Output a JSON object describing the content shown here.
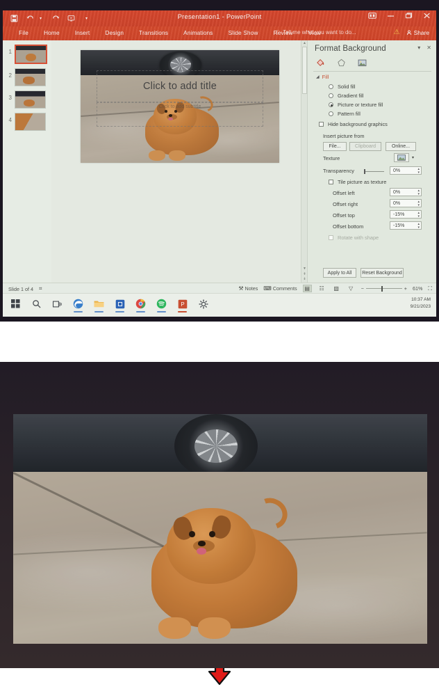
{
  "app": {
    "title": "Presentation1 - PowerPoint",
    "accent_color": "#e23d20",
    "quick_access": [
      {
        "name": "save-icon",
        "glyph": "⬜"
      },
      {
        "name": "undo-icon",
        "glyph": "↶"
      },
      {
        "name": "undo-dropdown-icon",
        "glyph": "▾"
      },
      {
        "name": "redo-icon",
        "glyph": "↷"
      },
      {
        "name": "start-slideshow-icon",
        "glyph": "▶"
      },
      {
        "name": "customize-quick-access-icon",
        "glyph": "▾"
      }
    ],
    "window_buttons": [
      {
        "name": "ribbon-display-options-button",
        "glyph": "▭"
      },
      {
        "name": "minimize-button",
        "glyph": "–"
      },
      {
        "name": "restore-button",
        "glyph": "❐"
      },
      {
        "name": "close-button",
        "glyph": "✕"
      }
    ],
    "warning_icon": "⚠",
    "share_label": "Share",
    "tell_me_placeholder": "Tell me what you want to do...",
    "tell_me_icon": "⚲"
  },
  "ribbon": {
    "tabs": [
      {
        "label": "File"
      },
      {
        "label": "Home"
      },
      {
        "label": "Insert"
      },
      {
        "label": "Design"
      },
      {
        "label": "Transitions"
      },
      {
        "label": "Animations"
      },
      {
        "label": "Slide Show"
      },
      {
        "label": "Review"
      },
      {
        "label": "View"
      }
    ]
  },
  "thumbnails": [
    {
      "number": "1",
      "selected": true
    },
    {
      "number": "2",
      "selected": false
    },
    {
      "number": "3",
      "selected": false
    },
    {
      "number": "4",
      "selected": false
    }
  ],
  "slide": {
    "title_placeholder": "Click to add title",
    "subtitle_placeholder": "Click to add subtitle"
  },
  "pane": {
    "title": "Format Background",
    "pin_icon": "▾",
    "close_icon": "✕",
    "icons": [
      {
        "name": "fill-bucket-icon",
        "selected": true
      },
      {
        "name": "effects-pentagon-icon",
        "selected": false
      },
      {
        "name": "picture-icon",
        "selected": false
      }
    ],
    "fill_section_label": "Fill",
    "fill_options": [
      {
        "label": "Solid fill",
        "selected": false
      },
      {
        "label": "Gradient fill",
        "selected": false
      },
      {
        "label": "Picture or texture fill",
        "selected": true
      },
      {
        "label": "Pattern fill",
        "selected": false
      }
    ],
    "hide_background_graphics": {
      "label": "Hide background graphics",
      "checked": false
    },
    "insert_picture_from_label": "Insert picture from",
    "insert_buttons": [
      {
        "label": "File...",
        "disabled": false
      },
      {
        "label": "Clipboard",
        "disabled": true
      },
      {
        "label": "Online...",
        "disabled": false
      }
    ],
    "texture_label": "Texture",
    "texture_dropdown_icon": "▾",
    "transparency": {
      "label": "Transparency",
      "value": "0%"
    },
    "tile_picture_as_texture": {
      "label": "Tile picture as texture",
      "checked": false
    },
    "offsets": [
      {
        "label": "Offset left",
        "value": "0%"
      },
      {
        "label": "Offset right",
        "value": "0%"
      },
      {
        "label": "Offset top",
        "value": "-15%"
      },
      {
        "label": "Offset bottom",
        "value": "-15%"
      }
    ],
    "rotate_with_shape": {
      "label": "Rotate with shape",
      "checked": false,
      "disabled": true
    },
    "apply_to_all_label": "Apply to All",
    "reset_background_label": "Reset Background"
  },
  "statusbar": {
    "slide_count": "Slide 1 of 4",
    "accessibility_icon": "⌗",
    "notes_label": "Notes",
    "notes_icon": "⚒",
    "comments_label": "Comments",
    "comments_icon": "⌨",
    "views": [
      {
        "name": "normal-view-button",
        "glyph": "▤",
        "active": true
      },
      {
        "name": "slide-sorter-button",
        "glyph": "☷",
        "active": false
      },
      {
        "name": "reading-view-button",
        "glyph": "▧",
        "active": false
      },
      {
        "name": "slideshow-button",
        "glyph": "▽",
        "active": false
      }
    ],
    "zoom_out_icon": "−",
    "zoom_in_icon": "+",
    "zoom_level": "61%",
    "fit_to_window_icon": "⛶"
  },
  "taskbar": {
    "items": [
      {
        "name": "start-button",
        "glyph": "⊞",
        "running": false
      },
      {
        "name": "search-icon",
        "glyph": "⌕",
        "running": false
      },
      {
        "name": "task-view-icon",
        "glyph": "⧉",
        "running": false
      },
      {
        "name": "edge-icon",
        "glyph": "",
        "running": true
      },
      {
        "name": "file-explorer-icon",
        "glyph": "",
        "running": true
      },
      {
        "name": "microsoft-store-icon",
        "glyph": "",
        "running": true
      },
      {
        "name": "chrome-icon",
        "glyph": "",
        "running": true
      },
      {
        "name": "spotify-icon",
        "glyph": "",
        "running": true
      },
      {
        "name": "powerpoint-icon",
        "glyph": "P",
        "running": true
      },
      {
        "name": "settings-gear-icon",
        "glyph": "⚙",
        "running": false
      }
    ],
    "clock_time": "10:37 AM",
    "clock_date": "9/21/2023"
  },
  "divider": {
    "arrow_color": "#e01b18",
    "arrow_name": "red-down-arrow"
  },
  "bottom": {
    "caption": "",
    "background_color": "#2a2228"
  }
}
